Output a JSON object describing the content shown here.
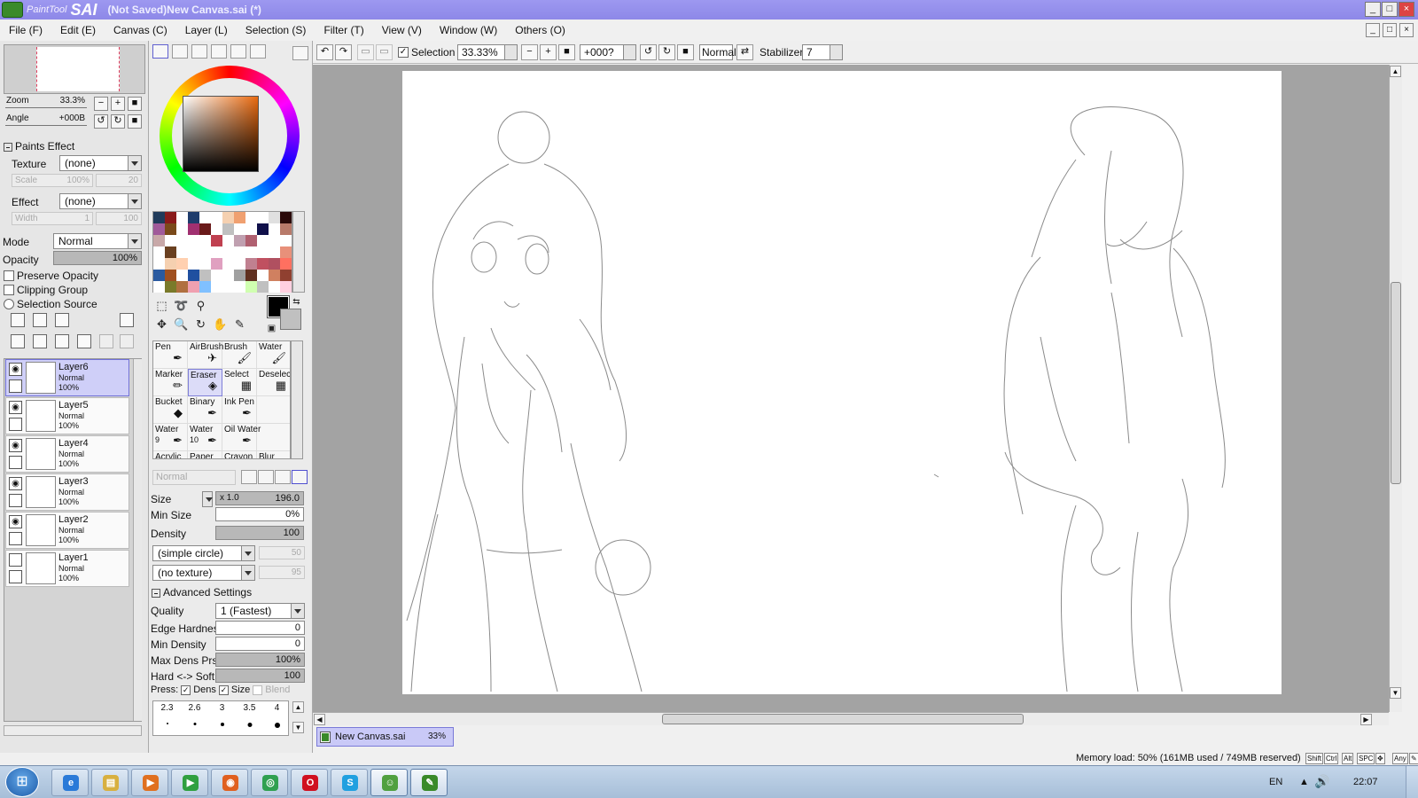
{
  "window": {
    "app_name": "PaintTool",
    "app_sai": "SAI",
    "title": "(Not Saved)New Canvas.sai (*)"
  },
  "menu": [
    "File (F)",
    "Edit (E)",
    "Canvas (C)",
    "Layer (L)",
    "Selection (S)",
    "Filter (T)",
    "View (V)",
    "Window (W)",
    "Others (O)"
  ],
  "navigator": {
    "zoom_label": "Zoom",
    "zoom_value": "33.3%",
    "angle_label": "Angle",
    "angle_value": "+000B"
  },
  "paints_effect": {
    "title": "Paints Effect",
    "texture_label": "Texture",
    "texture_value": "(none)",
    "scale_label": "Scale",
    "scale_value": "100%",
    "scale_amount": "20",
    "effect_label": "Effect",
    "effect_value": "(none)",
    "width_label": "Width",
    "width_value": "1",
    "width_amount": "100"
  },
  "layer_props": {
    "mode_label": "Mode",
    "mode_value": "Normal",
    "opacity_label": "Opacity",
    "opacity_value": "100%",
    "opacity_fraction": 1.0,
    "preserve_opacity": "Preserve Opacity",
    "clipping_group": "Clipping Group",
    "selection_source": "Selection Source"
  },
  "layers": [
    {
      "name": "Layer6",
      "mode": "Normal",
      "opacity": "100%",
      "visible": true,
      "selected": true
    },
    {
      "name": "Layer5",
      "mode": "Normal",
      "opacity": "100%",
      "visible": true,
      "selected": false
    },
    {
      "name": "Layer4",
      "mode": "Normal",
      "opacity": "100%",
      "visible": true,
      "selected": false
    },
    {
      "name": "Layer3",
      "mode": "Normal",
      "opacity": "100%",
      "visible": true,
      "selected": false
    },
    {
      "name": "Layer2",
      "mode": "Normal",
      "opacity": "100%",
      "visible": true,
      "selected": false
    },
    {
      "name": "Layer1",
      "mode": "Normal",
      "opacity": "100%",
      "visible": false,
      "selected": false
    }
  ],
  "swatch_colors": [
    "#1f3a5a",
    "#8a1a1a",
    "#ffffff",
    "#1e3c6c",
    "#ffffff",
    "#ffffff",
    "#f5d0b0",
    "#f0a070",
    "#ffffff",
    "#ffffff",
    "#e0e0e0",
    "#2a0a0a",
    "#a05a9a",
    "#7a4a1a",
    "#ffffff",
    "#a03070",
    "#6a1a1a",
    "#ffffff",
    "#c0c0c0",
    "#ffffff",
    "#ffffff",
    "#10104a",
    "#ffffff",
    "#b87a6a",
    "#c8a8a8",
    "#ffffff",
    "#ffffff",
    "#ffffff",
    "#ffffff",
    "#c04050",
    "#ffffff",
    "#c0a0b0",
    "#b06070",
    "#ffffff",
    "#ffffff",
    "#ffffff",
    "#ffffff",
    "#6a4020",
    "#ffffff",
    "#ffffff",
    "#ffffff",
    "#ffffff",
    "#ffffff",
    "#ffffff",
    "#ffffff",
    "#ffffff",
    "#ffffff",
    "#e8907a",
    "#ffffff",
    "#f5d0b0",
    "#ffd0b0",
    "#ffffff",
    "#ffffff",
    "#e0a0c0",
    "#ffffff",
    "#ffffff",
    "#c08090",
    "#c05060",
    "#b05060",
    "#ff7060",
    "#2a5aa0",
    "#a05020",
    "#ffffff",
    "#2050a0",
    "#c0c0c0",
    "#ffffff",
    "#ffffff",
    "#a0a0a0",
    "#603020",
    "#ffffff",
    "#d08060",
    "#904030",
    "#ffffff",
    "#7a7a2a",
    "#b07040",
    "#f0a0b0",
    "#80c0ff",
    "#ffffff",
    "#ffffff",
    "#ffffff",
    "#d0ffb0",
    "#c0c0c0",
    "#ffffff",
    "#ffd0e0"
  ],
  "tools": [
    {
      "label": "Pen",
      "sub": "",
      "icon": "pen-icon",
      "glyph": "✒"
    },
    {
      "label": "AirBrush",
      "sub": "",
      "icon": "airbrush-icon",
      "glyph": "✈"
    },
    {
      "label": "Brush",
      "sub": "",
      "icon": "brush-icon",
      "glyph": "🖌"
    },
    {
      "label": "Water",
      "sub": "",
      "icon": "water-brush-icon",
      "glyph": "🖌"
    },
    {
      "label": "Marker",
      "sub": "",
      "icon": "marker-icon",
      "glyph": "✏"
    },
    {
      "label": "Eraser",
      "sub": "",
      "icon": "eraser-icon",
      "glyph": "◈"
    },
    {
      "label": "Select",
      "sub": "",
      "icon": "select-brush-icon",
      "glyph": "▦"
    },
    {
      "label": "Deselect",
      "sub": "",
      "icon": "deselect-brush-icon",
      "glyph": "▦"
    },
    {
      "label": "Bucket",
      "sub": "",
      "icon": "bucket-icon",
      "glyph": "◆"
    },
    {
      "label": "Binary",
      "sub": "",
      "icon": "binary-pen-icon",
      "glyph": "✒"
    },
    {
      "label": "Ink Pen",
      "sub": "",
      "icon": "ink-pen-icon",
      "glyph": "✒"
    },
    {
      "label": "",
      "sub": "",
      "icon": "empty-slot",
      "glyph": ""
    },
    {
      "label": "Water",
      "sub": "9",
      "icon": "water-9-icon",
      "glyph": "✒"
    },
    {
      "label": "Water",
      "sub": "10",
      "icon": "water-10-icon",
      "glyph": "✒"
    },
    {
      "label": "Oil Water",
      "sub": "",
      "icon": "oil-water-icon",
      "glyph": "✒"
    },
    {
      "label": "",
      "sub": "",
      "icon": "empty-slot",
      "glyph": ""
    },
    {
      "label": "Acrylic",
      "sub": "",
      "icon": "acrylic-icon",
      "glyph": ""
    },
    {
      "label": "Paper",
      "sub": "",
      "icon": "paper-icon",
      "glyph": ""
    },
    {
      "label": "Crayon",
      "sub": "",
      "icon": "crayon-icon",
      "glyph": ""
    },
    {
      "label": "Blur",
      "sub": "",
      "icon": "blur-icon",
      "glyph": ""
    }
  ],
  "brush": {
    "blend_mode": "Normal",
    "size_label": "Size",
    "size_mult": "x 1.0",
    "size_value": "196.0",
    "min_size_label": "Min Size",
    "min_size_value": "0%",
    "density_label": "Density",
    "density_value": "100",
    "shape_value": "(simple circle)",
    "shape_amount": "50",
    "texture_value": "(no texture)",
    "texture_amount": "95",
    "advanced_label": "Advanced Settings",
    "quality_label": "Quality",
    "quality_value": "1 (Fastest)",
    "edge_hardness_label": "Edge Hardness",
    "edge_hardness_value": "0",
    "min_density_label": "Min Density",
    "min_density_value": "0",
    "max_dens_label": "Max Dens Prs.",
    "max_dens_value": "100%",
    "hard_soft_label": "Hard <-> Soft",
    "hard_soft_value": "100",
    "press_label": "Press:",
    "press_dens": "Dens",
    "press_size": "Size",
    "press_blend": "Blend",
    "presets": [
      "2.3",
      "2.6",
      "3",
      "3.5",
      "4"
    ]
  },
  "canvas_toolbar": {
    "selection_label": "Selection",
    "zoom_value": "33.33%",
    "angle_value": "+000?",
    "blend_mode": "Normal",
    "stabilizer_label": "Stabilizer",
    "stabilizer_value": "7"
  },
  "doc_tab": {
    "name": "New Canvas.sai",
    "zoom": "33%"
  },
  "status": {
    "memory": "Memory load: 50% (161MB used / 749MB reserved)",
    "keys": [
      "Shift",
      "Ctrl",
      "Alt",
      "SPC",
      "✥",
      "Any",
      "✎"
    ]
  },
  "taskbar": {
    "apps": [
      {
        "name": "internet-explorer",
        "glyph": "e",
        "color": "#2a7ad8"
      },
      {
        "name": "file-explorer",
        "glyph": "▤",
        "color": "#d8b040"
      },
      {
        "name": "media-player",
        "glyph": "▶",
        "color": "#e07020"
      },
      {
        "name": "media-center",
        "glyph": "▶",
        "color": "#30a040"
      },
      {
        "name": "firefox",
        "glyph": "◉",
        "color": "#e06020"
      },
      {
        "name": "chrome",
        "glyph": "◎",
        "color": "#30a050"
      },
      {
        "name": "opera",
        "glyph": "O",
        "color": "#d01020"
      },
      {
        "name": "skype",
        "glyph": "S",
        "color": "#20a0e0"
      },
      {
        "name": "messenger",
        "glyph": "☺",
        "color": "#50a040"
      },
      {
        "name": "painttool-sai",
        "glyph": "✎",
        "color": "#3a8a2a"
      }
    ],
    "language": "EN",
    "tray_arrow": "▲",
    "volume_icon": "🔊",
    "clock": "22:07"
  }
}
